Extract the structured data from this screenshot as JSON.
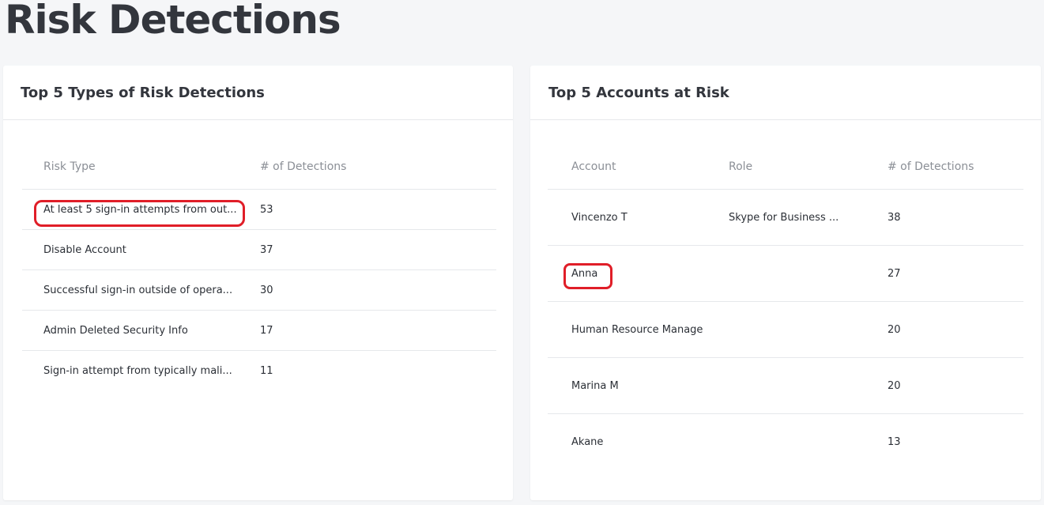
{
  "page": {
    "title": "Risk Detections"
  },
  "risk_types_card": {
    "title": "Top 5 Types of Risk Detections",
    "columns": [
      "Risk Type",
      "# of Detections"
    ],
    "rows": [
      {
        "type": "At least 5 sign-in attempts from out...",
        "detections": "53"
      },
      {
        "type": "Disable Account",
        "detections": "37"
      },
      {
        "type": "Successful sign-in outside of opera...",
        "detections": "30"
      },
      {
        "type": "Admin Deleted Security Info",
        "detections": "17"
      },
      {
        "type": "Sign-in attempt from typically mali...",
        "detections": "11"
      }
    ]
  },
  "accounts_card": {
    "title": "Top 5 Accounts at Risk",
    "columns": [
      "Account",
      "Role",
      "# of Detections"
    ],
    "rows": [
      {
        "account": "Vincenzo T",
        "role": "Skype for Business ...",
        "detections": "38"
      },
      {
        "account": "Anna",
        "role": "",
        "detections": "27"
      },
      {
        "account": "Human Resource Manage",
        "role": "",
        "detections": "20"
      },
      {
        "account": "Marina M",
        "role": "",
        "detections": "20"
      },
      {
        "account": "Akane",
        "role": "",
        "detections": "13"
      }
    ]
  },
  "annotations": {
    "highlight_color": "#e01e28"
  }
}
